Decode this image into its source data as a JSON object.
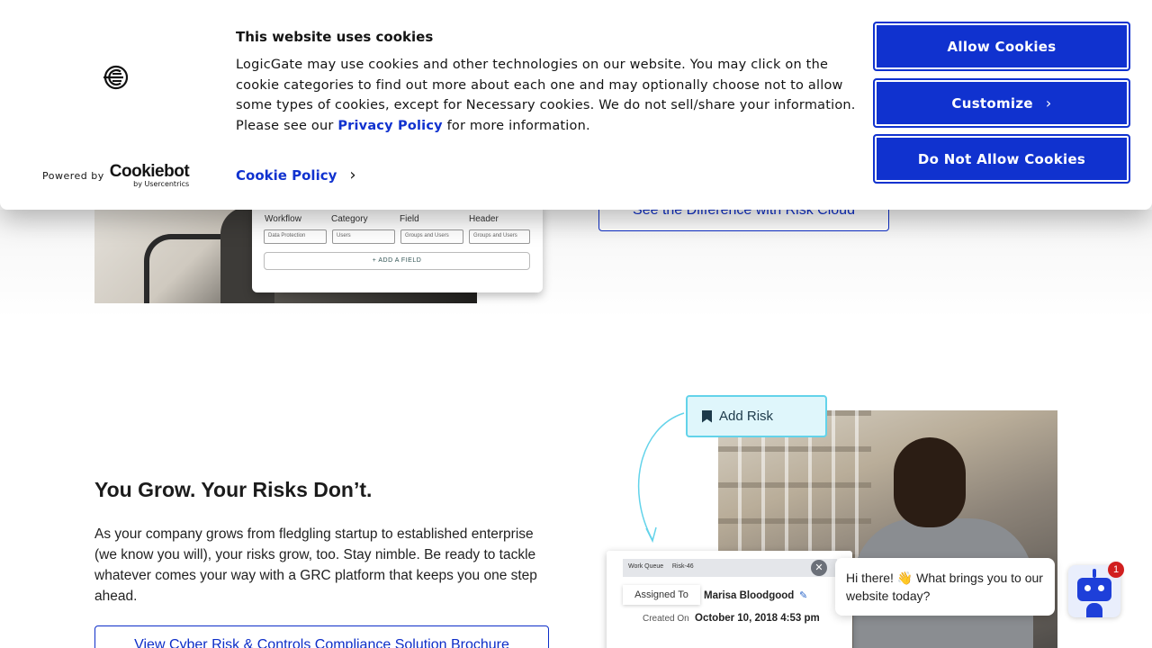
{
  "cookie_banner": {
    "title": "This website uses cookies",
    "body_before_link": "LogicGate may use cookies and other technologies on our website. You may click on the cookie categories to find out more about each one and may optionally choose not to allow some types of cookies, except for Necessary cookies.  We do not sell/share your information. Please see our ",
    "privacy_link": "Privacy Policy",
    "body_after_link": " for more information.",
    "cookie_policy_link": "Cookie Policy",
    "powered_by": "Powered by",
    "cookiebot_word": "Cookiebot",
    "cookiebot_sub": "by Usercentrics",
    "buttons": {
      "allow": "Allow Cookies",
      "customize": "Customize",
      "deny": "Do Not Allow Cookies"
    },
    "accent_color": "#1032cf"
  },
  "hero": {
    "ui_card": {
      "columns": [
        {
          "label": "Workflow",
          "value": "Data Protection"
        },
        {
          "label": "Category",
          "value": "Users"
        },
        {
          "label": "Field",
          "value": "Groups and Users"
        },
        {
          "label": "Header",
          "value": "Groups and Users"
        }
      ],
      "add_field": "+ ADD A FIELD"
    },
    "cta": "See the Difference with Risk Cloud"
  },
  "section": {
    "title": "You Grow. Your Risks Don’t.",
    "body": "As your company grows from fledgling startup to established enterprise (we know you will), your risks grow, too. Stay nimble. Be ready to tackle whatever comes your way with a GRC platform that keeps you one step ahead.",
    "cta": "View Cyber Risk & Controls Compliance Solution Brochure"
  },
  "illustration": {
    "add_risk": "Add Risk",
    "work_queue": "Work Queue",
    "risk_id": "Risk-46",
    "assigned_label": "Assigned To",
    "assigned_value": "Marisa Bloodgood",
    "created_label": "Created On",
    "created_value": "October 10, 2018 4:53 pm"
  },
  "chat": {
    "message": "Hi there! 👋 What brings you to our website today?",
    "badge_count": "1"
  }
}
